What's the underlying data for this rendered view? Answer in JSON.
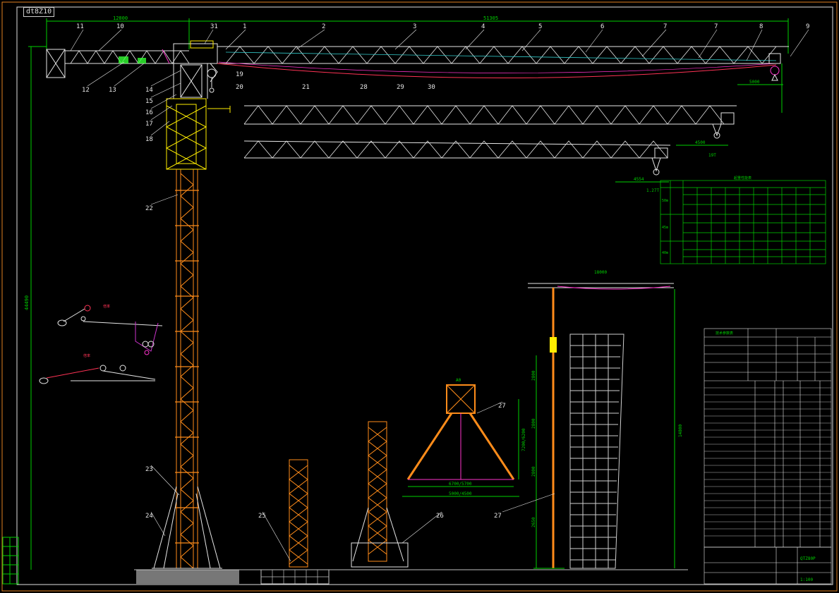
{
  "drawing_code": "dt8Z10",
  "top_dims": [
    "12800",
    "51305"
  ],
  "callouts": [
    "11",
    "10",
    "31",
    "1",
    "2",
    "3",
    "4",
    "5",
    "6",
    "7",
    "7",
    "8",
    "9",
    "12",
    "13",
    "14",
    "15",
    "16",
    "17",
    "18",
    "19",
    "20",
    "21",
    "28",
    "29",
    "30",
    "22",
    "23",
    "24",
    "25",
    "26",
    "27",
    "27"
  ],
  "boom_dims": [
    "5000",
    "4500",
    "19T",
    "4554",
    "1.27T"
  ],
  "height_dims": [
    "44490",
    "18000",
    "14800",
    "2800",
    "2800",
    "2800",
    "2650"
  ],
  "detail_labels": [
    "A0",
    "6700/5700",
    "5000/4500",
    "7200/6200",
    "A"
  ],
  "load_table_title": "起重性能表",
  "load_table_rows": [
    "50m",
    "45m",
    "40m"
  ],
  "info_table_title": "技术参数表",
  "title_block": [
    "QTZ80P",
    "1:100"
  ],
  "colors": {
    "structure": "#ff8c1a",
    "boom": "#e6e6e6",
    "pink": "#ff33cc",
    "yellow": "#ffee00",
    "cyan": "#33cccc",
    "green": "#33ff33",
    "table": "#00d000"
  }
}
